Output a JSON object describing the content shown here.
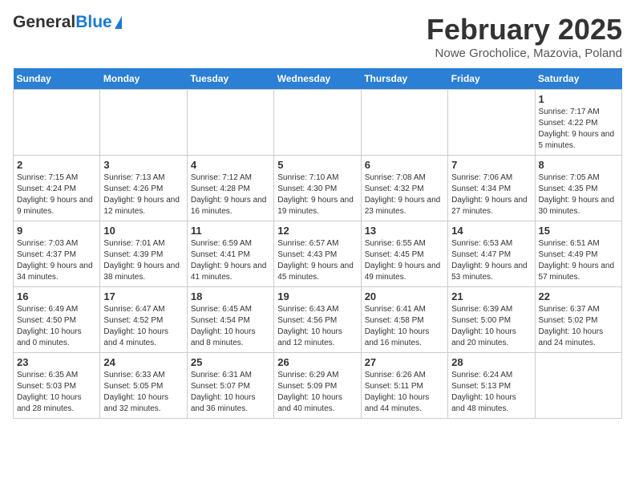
{
  "header": {
    "logo_general": "General",
    "logo_blue": "Blue",
    "title": "February 2025",
    "subtitle": "Nowe Grocholice, Mazovia, Poland"
  },
  "days_of_week": [
    "Sunday",
    "Monday",
    "Tuesday",
    "Wednesday",
    "Thursday",
    "Friday",
    "Saturday"
  ],
  "weeks": [
    [
      {
        "day": "",
        "info": ""
      },
      {
        "day": "",
        "info": ""
      },
      {
        "day": "",
        "info": ""
      },
      {
        "day": "",
        "info": ""
      },
      {
        "day": "",
        "info": ""
      },
      {
        "day": "",
        "info": ""
      },
      {
        "day": "1",
        "info": "Sunrise: 7:17 AM\nSunset: 4:22 PM\nDaylight: 9 hours and 5 minutes."
      }
    ],
    [
      {
        "day": "2",
        "info": "Sunrise: 7:15 AM\nSunset: 4:24 PM\nDaylight: 9 hours and 9 minutes."
      },
      {
        "day": "3",
        "info": "Sunrise: 7:13 AM\nSunset: 4:26 PM\nDaylight: 9 hours and 12 minutes."
      },
      {
        "day": "4",
        "info": "Sunrise: 7:12 AM\nSunset: 4:28 PM\nDaylight: 9 hours and 16 minutes."
      },
      {
        "day": "5",
        "info": "Sunrise: 7:10 AM\nSunset: 4:30 PM\nDaylight: 9 hours and 19 minutes."
      },
      {
        "day": "6",
        "info": "Sunrise: 7:08 AM\nSunset: 4:32 PM\nDaylight: 9 hours and 23 minutes."
      },
      {
        "day": "7",
        "info": "Sunrise: 7:06 AM\nSunset: 4:34 PM\nDaylight: 9 hours and 27 minutes."
      },
      {
        "day": "8",
        "info": "Sunrise: 7:05 AM\nSunset: 4:35 PM\nDaylight: 9 hours and 30 minutes."
      }
    ],
    [
      {
        "day": "9",
        "info": "Sunrise: 7:03 AM\nSunset: 4:37 PM\nDaylight: 9 hours and 34 minutes."
      },
      {
        "day": "10",
        "info": "Sunrise: 7:01 AM\nSunset: 4:39 PM\nDaylight: 9 hours and 38 minutes."
      },
      {
        "day": "11",
        "info": "Sunrise: 6:59 AM\nSunset: 4:41 PM\nDaylight: 9 hours and 41 minutes."
      },
      {
        "day": "12",
        "info": "Sunrise: 6:57 AM\nSunset: 4:43 PM\nDaylight: 9 hours and 45 minutes."
      },
      {
        "day": "13",
        "info": "Sunrise: 6:55 AM\nSunset: 4:45 PM\nDaylight: 9 hours and 49 minutes."
      },
      {
        "day": "14",
        "info": "Sunrise: 6:53 AM\nSunset: 4:47 PM\nDaylight: 9 hours and 53 minutes."
      },
      {
        "day": "15",
        "info": "Sunrise: 6:51 AM\nSunset: 4:49 PM\nDaylight: 9 hours and 57 minutes."
      }
    ],
    [
      {
        "day": "16",
        "info": "Sunrise: 6:49 AM\nSunset: 4:50 PM\nDaylight: 10 hours and 0 minutes."
      },
      {
        "day": "17",
        "info": "Sunrise: 6:47 AM\nSunset: 4:52 PM\nDaylight: 10 hours and 4 minutes."
      },
      {
        "day": "18",
        "info": "Sunrise: 6:45 AM\nSunset: 4:54 PM\nDaylight: 10 hours and 8 minutes."
      },
      {
        "day": "19",
        "info": "Sunrise: 6:43 AM\nSunset: 4:56 PM\nDaylight: 10 hours and 12 minutes."
      },
      {
        "day": "20",
        "info": "Sunrise: 6:41 AM\nSunset: 4:58 PM\nDaylight: 10 hours and 16 minutes."
      },
      {
        "day": "21",
        "info": "Sunrise: 6:39 AM\nSunset: 5:00 PM\nDaylight: 10 hours and 20 minutes."
      },
      {
        "day": "22",
        "info": "Sunrise: 6:37 AM\nSunset: 5:02 PM\nDaylight: 10 hours and 24 minutes."
      }
    ],
    [
      {
        "day": "23",
        "info": "Sunrise: 6:35 AM\nSunset: 5:03 PM\nDaylight: 10 hours and 28 minutes."
      },
      {
        "day": "24",
        "info": "Sunrise: 6:33 AM\nSunset: 5:05 PM\nDaylight: 10 hours and 32 minutes."
      },
      {
        "day": "25",
        "info": "Sunrise: 6:31 AM\nSunset: 5:07 PM\nDaylight: 10 hours and 36 minutes."
      },
      {
        "day": "26",
        "info": "Sunrise: 6:29 AM\nSunset: 5:09 PM\nDaylight: 10 hours and 40 minutes."
      },
      {
        "day": "27",
        "info": "Sunrise: 6:26 AM\nSunset: 5:11 PM\nDaylight: 10 hours and 44 minutes."
      },
      {
        "day": "28",
        "info": "Sunrise: 6:24 AM\nSunset: 5:13 PM\nDaylight: 10 hours and 48 minutes."
      },
      {
        "day": "",
        "info": ""
      }
    ]
  ]
}
